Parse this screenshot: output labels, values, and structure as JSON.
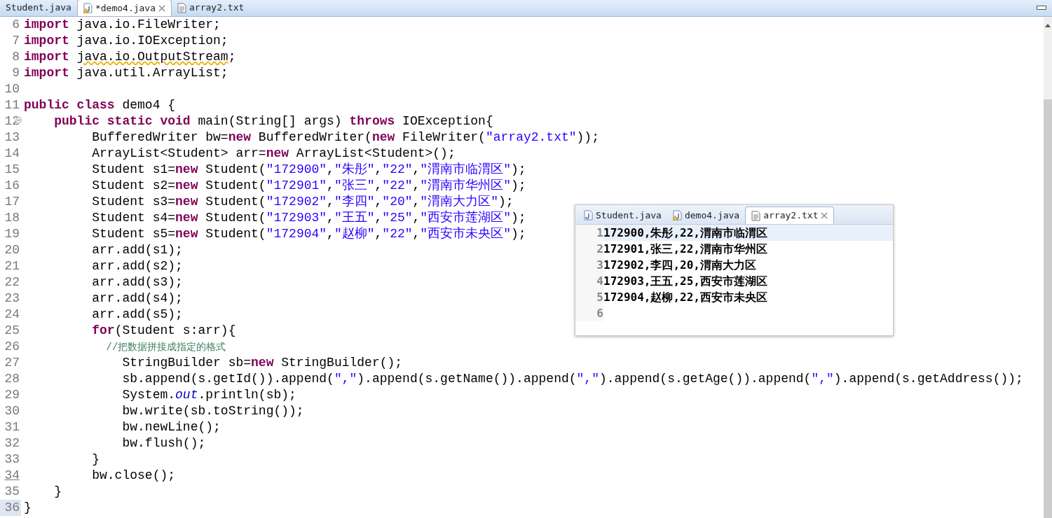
{
  "editor_tabs": [
    {
      "label": "Student.java",
      "kind": "plain",
      "selected": false,
      "closable": false
    },
    {
      "label": "*demo4.java",
      "kind": "javawarn",
      "selected": true,
      "closable": true
    },
    {
      "label": "array2.txt",
      "kind": "text",
      "selected": false,
      "closable": false
    }
  ],
  "code_lines": [
    {
      "number": "6",
      "tokens": [
        {
          "kind": "keyword",
          "text": "import"
        },
        {
          "kind": "plain",
          "text": " java.io.FileWriter;"
        }
      ]
    },
    {
      "number": "7",
      "tokens": [
        {
          "kind": "keyword",
          "text": "import"
        },
        {
          "kind": "plain",
          "text": " java.io.IOException;"
        }
      ]
    },
    {
      "number": "8",
      "tokens": [
        {
          "kind": "keyword",
          "text": "import "
        },
        {
          "kind": "warning",
          "text": "java.io.OutputStream"
        },
        {
          "kind": "plain",
          "text": ";"
        }
      ]
    },
    {
      "number": "9",
      "tokens": [
        {
          "kind": "keyword",
          "text": "import"
        },
        {
          "kind": "plain",
          "text": " java.util.ArrayList;"
        }
      ]
    },
    {
      "number": "10"
    },
    {
      "number": "11",
      "tokens": [
        {
          "kind": "keyword",
          "text": "public class"
        },
        {
          "kind": "plain",
          "text": " demo4 {"
        }
      ]
    },
    {
      "number": "12",
      "fold": true,
      "tokens": [
        {
          "kind": "keyword",
          "text": "    public static void"
        },
        {
          "kind": "plain",
          "text": " main(String[] args) "
        },
        {
          "kind": "keyword",
          "text": "throws"
        },
        {
          "kind": "plain",
          "text": " IOException{"
        }
      ]
    },
    {
      "number": "13",
      "tokens": [
        {
          "kind": "plain",
          "text": "         BufferedWriter bw="
        },
        {
          "kind": "keyword",
          "text": "new"
        },
        {
          "kind": "plain",
          "text": " BufferedWriter("
        },
        {
          "kind": "keyword",
          "text": "new"
        },
        {
          "kind": "plain",
          "text": " FileWriter("
        },
        {
          "kind": "string",
          "text": "\"array2.txt\""
        },
        {
          "kind": "plain",
          "text": "));"
        }
      ]
    },
    {
      "number": "14",
      "tokens": [
        {
          "kind": "plain",
          "text": "         ArrayList<Student> arr="
        },
        {
          "kind": "keyword",
          "text": "new"
        },
        {
          "kind": "plain",
          "text": " ArrayList<Student>();"
        }
      ]
    },
    {
      "number": "15",
      "tokens": [
        {
          "kind": "plain",
          "text": "         Student s1="
        },
        {
          "kind": "keyword",
          "text": "new"
        },
        {
          "kind": "plain",
          "text": " Student("
        },
        {
          "kind": "string",
          "text": "\"172900\""
        },
        {
          "kind": "plain",
          "text": ","
        },
        {
          "kind": "string",
          "text": "\"朱彤\""
        },
        {
          "kind": "plain",
          "text": ","
        },
        {
          "kind": "string",
          "text": "\"22\""
        },
        {
          "kind": "plain",
          "text": ","
        },
        {
          "kind": "string",
          "text": "\"渭南市临渭区\""
        },
        {
          "kind": "plain",
          "text": ");"
        }
      ]
    },
    {
      "number": "16",
      "tokens": [
        {
          "kind": "plain",
          "text": "         Student s2="
        },
        {
          "kind": "keyword",
          "text": "new"
        },
        {
          "kind": "plain",
          "text": " Student("
        },
        {
          "kind": "string",
          "text": "\"172901\""
        },
        {
          "kind": "plain",
          "text": ","
        },
        {
          "kind": "string",
          "text": "\"张三\""
        },
        {
          "kind": "plain",
          "text": ","
        },
        {
          "kind": "string",
          "text": "\"22\""
        },
        {
          "kind": "plain",
          "text": ","
        },
        {
          "kind": "string",
          "text": "\"渭南市华州区\""
        },
        {
          "kind": "plain",
          "text": ");"
        }
      ]
    },
    {
      "number": "17",
      "tokens": [
        {
          "kind": "plain",
          "text": "         Student s3="
        },
        {
          "kind": "keyword",
          "text": "new"
        },
        {
          "kind": "plain",
          "text": " Student("
        },
        {
          "kind": "string",
          "text": "\"172902\""
        },
        {
          "kind": "plain",
          "text": ","
        },
        {
          "kind": "string",
          "text": "\"李四\""
        },
        {
          "kind": "plain",
          "text": ","
        },
        {
          "kind": "string",
          "text": "\"20\""
        },
        {
          "kind": "plain",
          "text": ","
        },
        {
          "kind": "string",
          "text": "\"渭南大力区\""
        },
        {
          "kind": "plain",
          "text": ");"
        }
      ]
    },
    {
      "number": "18",
      "tokens": [
        {
          "kind": "plain",
          "text": "         Student s4="
        },
        {
          "kind": "keyword",
          "text": "new"
        },
        {
          "kind": "plain",
          "text": " Student("
        },
        {
          "kind": "string",
          "text": "\"172903\""
        },
        {
          "kind": "plain",
          "text": ","
        },
        {
          "kind": "string",
          "text": "\"王五\""
        },
        {
          "kind": "plain",
          "text": ","
        },
        {
          "kind": "string",
          "text": "\"25\""
        },
        {
          "kind": "plain",
          "text": ","
        },
        {
          "kind": "string",
          "text": "\"西安市莲湖区\""
        },
        {
          "kind": "plain",
          "text": ");"
        }
      ]
    },
    {
      "number": "19",
      "tokens": [
        {
          "kind": "plain",
          "text": "         Student s5="
        },
        {
          "kind": "keyword",
          "text": "new"
        },
        {
          "kind": "plain",
          "text": " Student("
        },
        {
          "kind": "string",
          "text": "\"172904\""
        },
        {
          "kind": "plain",
          "text": ","
        },
        {
          "kind": "string",
          "text": "\"赵柳\""
        },
        {
          "kind": "plain",
          "text": ","
        },
        {
          "kind": "string",
          "text": "\"22\""
        },
        {
          "kind": "plain",
          "text": ","
        },
        {
          "kind": "string",
          "text": "\"西安市未央区\""
        },
        {
          "kind": "plain",
          "text": ");"
        }
      ]
    },
    {
      "number": "20",
      "tokens": [
        {
          "kind": "plain",
          "text": "         arr.add(s1);"
        }
      ]
    },
    {
      "number": "21",
      "tokens": [
        {
          "kind": "plain",
          "text": "         arr.add(s2);"
        }
      ]
    },
    {
      "number": "22",
      "tokens": [
        {
          "kind": "plain",
          "text": "         arr.add(s3);"
        }
      ]
    },
    {
      "number": "23",
      "tokens": [
        {
          "kind": "plain",
          "text": "         arr.add(s4);"
        }
      ]
    },
    {
      "number": "24",
      "tokens": [
        {
          "kind": "plain",
          "text": "         arr.add(s5);"
        }
      ]
    },
    {
      "number": "25",
      "tokens": [
        {
          "kind": "keyword",
          "text": "         for"
        },
        {
          "kind": "plain",
          "text": "(Student s:arr){"
        }
      ]
    },
    {
      "number": "26",
      "tokens": [
        {
          "kind": "comment",
          "text": "              //把数据拼接成指定的格式"
        }
      ]
    },
    {
      "number": "27",
      "tokens": [
        {
          "kind": "plain",
          "text": "             StringBuilder sb="
        },
        {
          "kind": "keyword",
          "text": "new"
        },
        {
          "kind": "plain",
          "text": " StringBuilder();"
        }
      ]
    },
    {
      "number": "28",
      "tokens": [
        {
          "kind": "plain",
          "text": "             sb.append(s.getId()).append("
        },
        {
          "kind": "string",
          "text": "\",\""
        },
        {
          "kind": "plain",
          "text": ").append(s.getName()).append("
        },
        {
          "kind": "string",
          "text": "\",\""
        },
        {
          "kind": "plain",
          "text": ").append(s.getAge()).append("
        },
        {
          "kind": "string",
          "text": "\",\""
        },
        {
          "kind": "plain",
          "text": ").append(s.getAddress());"
        }
      ]
    },
    {
      "number": "29",
      "tokens": [
        {
          "kind": "plain",
          "text": "             System."
        },
        {
          "kind": "static",
          "text": "out"
        },
        {
          "kind": "plain",
          "text": ".println(sb);"
        }
      ]
    },
    {
      "number": "30",
      "tokens": [
        {
          "kind": "plain",
          "text": "             bw.write(sb.toString());"
        }
      ]
    },
    {
      "number": "31",
      "tokens": [
        {
          "kind": "plain",
          "text": "             bw.newLine();"
        }
      ]
    },
    {
      "number": "32",
      "tokens": [
        {
          "kind": "plain",
          "text": "             bw.flush();"
        }
      ]
    },
    {
      "number": "33",
      "tokens": [
        {
          "kind": "plain",
          "text": "         }"
        }
      ]
    },
    {
      "number": "34",
      "tokens": [
        {
          "kind": "plain",
          "text": "         bw.close();"
        }
      ]
    },
    {
      "number": "35",
      "tokens": [
        {
          "kind": "plain",
          "text": "    }"
        }
      ]
    },
    {
      "number": "36",
      "tokens": [
        {
          "kind": "plain",
          "text": "}"
        }
      ]
    }
  ],
  "popup": {
    "tabs": [
      {
        "label": "Student.java",
        "kind": "java",
        "selected": false,
        "closable": false
      },
      {
        "label": "demo4.java",
        "kind": "javawarn",
        "selected": false,
        "closable": false
      },
      {
        "label": "array2.txt",
        "kind": "text",
        "selected": true,
        "closable": true
      }
    ],
    "lines": [
      {
        "number": "1",
        "text": "172900,朱彤,22,渭南市临渭区",
        "current": true
      },
      {
        "number": "2",
        "text": "172901,张三,22,渭南市华州区",
        "current": false
      },
      {
        "number": "3",
        "text": "172902,李四,20,渭南大力区",
        "current": false
      },
      {
        "number": "4",
        "text": "172903,王五,25,西安市莲湖区",
        "current": false
      },
      {
        "number": "5",
        "text": "172904,赵柳,22,西安市未央区",
        "current": false
      },
      {
        "number": "6",
        "current": false
      }
    ]
  }
}
